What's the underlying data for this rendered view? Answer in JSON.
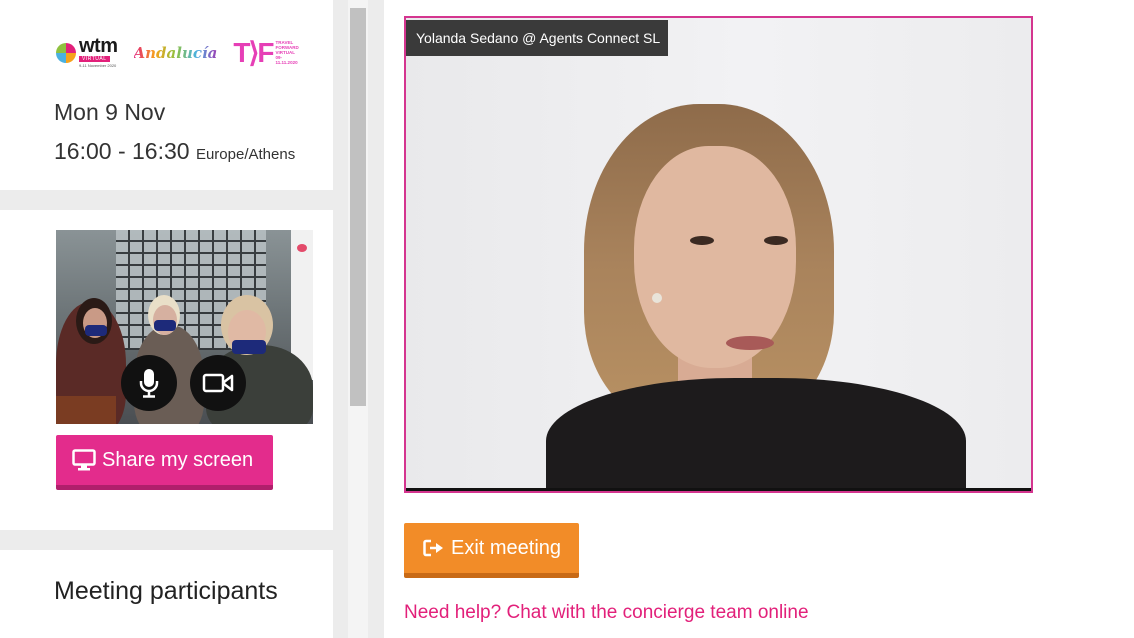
{
  "schedule": {
    "logos": {
      "wtm": {
        "word": "wtm",
        "tag": "VIRTUAL",
        "dates": "9-11 November 2020"
      },
      "andalucia": {
        "word": "Andalucía"
      },
      "ttf": {
        "big": "T⟩F",
        "small": [
          "TRAVEL",
          "FORWARD",
          "VIRTUAL",
          "09-",
          "11.11.2020"
        ]
      }
    },
    "date": "Mon 9 Nov",
    "time": "16:00 - 16:30",
    "timezone": "Europe/Athens"
  },
  "self_view": {
    "mic_icon": "microphone-icon",
    "camera_icon": "video-camera-icon",
    "share_label": "Share my screen",
    "share_icon": "monitor-icon"
  },
  "participants": {
    "title": "Meeting participants"
  },
  "remote": {
    "name_tag": "Yolanda Sedano @ Agents Connect SL"
  },
  "actions": {
    "exit_label": "Exit meeting",
    "exit_icon": "sign-out-icon",
    "help_link": "Need help? Chat with the concierge team online"
  },
  "colors": {
    "accent_pink": "#e32c8c",
    "accent_orange": "#f28c28",
    "link_pink": "#e2207a",
    "video_border": "#d4358f"
  }
}
